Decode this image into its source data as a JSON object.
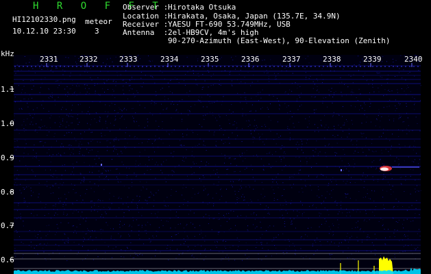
{
  "header": {
    "program": "H R O F F T",
    "filename": "HI12102330.png",
    "datetime": "10.12.10 23:30",
    "meteor_label": "meteor",
    "meteor_count": "3",
    "info_labels": [
      "Observer :",
      "Location :",
      "Receiver :",
      "Antenna  :"
    ],
    "info_values": [
      "Hirotaka Otsuka",
      "Hirakata, Osaka, Japan (135.7E, 34.9N)",
      "YAESU FT-690 53.749MHz, USB",
      "2el-HB9CV, 4m's high"
    ],
    "antenna_line2": "90-270-Azimuth (East-West), 90-Elevation (Zenith)"
  },
  "spectrogram": {
    "freq_unit": "kHz",
    "freq_labels": [
      "1.1",
      "1.0",
      "0.9",
      "0.8",
      "0.7",
      "0.6"
    ],
    "time_labels": [
      "2331",
      "2332",
      "2333",
      "2334",
      "2335",
      "2336",
      "2337",
      "2338",
      "2339",
      "2340"
    ],
    "colors": {
      "background": "#000010",
      "noise": "#1a1ad0",
      "axis": "#ffffff",
      "title": "#2fdc2f",
      "signal": "#ffff00",
      "trace": "#00d8ff"
    }
  }
}
